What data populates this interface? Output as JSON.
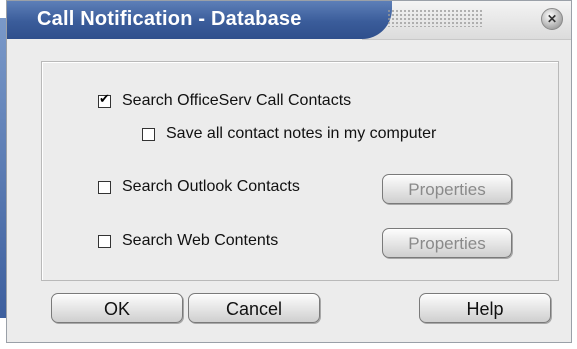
{
  "window": {
    "title": "Call Notification - Database",
    "close_glyph": "✕"
  },
  "options": {
    "search_officeserv": {
      "label": "Search OfficeServ Call Contacts",
      "checked": true
    },
    "save_notes": {
      "label": "Save all contact notes in my computer",
      "checked": false
    },
    "search_outlook": {
      "label": "Search Outlook Contacts",
      "checked": false
    },
    "search_web": {
      "label": "Search Web Contents",
      "checked": false
    }
  },
  "buttons": {
    "properties_outlook": "Properties",
    "properties_web": "Properties",
    "ok": "OK",
    "cancel": "Cancel",
    "help": "Help"
  },
  "colors": {
    "title_bar": "#3a5c9a",
    "dialog_bg": "#ececec"
  }
}
